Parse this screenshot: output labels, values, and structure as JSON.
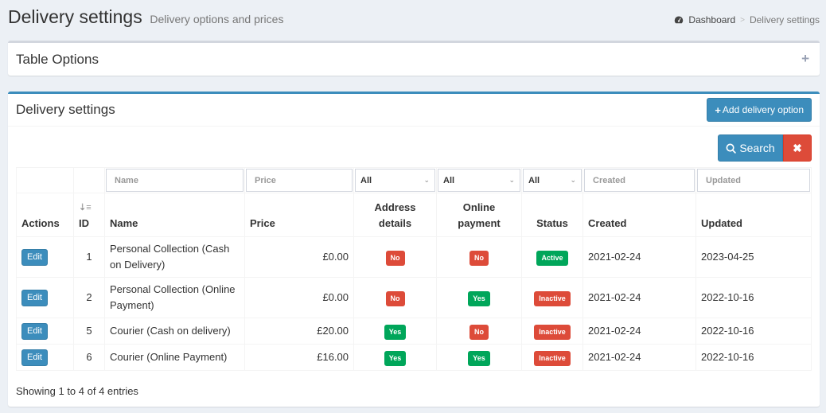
{
  "header": {
    "title": "Delivery settings",
    "subtitle": "Delivery options and prices",
    "breadcrumb": {
      "icon": "dashboard-icon",
      "home": "Dashboard",
      "separator": ">",
      "current": "Delivery settings"
    }
  },
  "table_options": {
    "title": "Table Options",
    "expand_icon": "+"
  },
  "main_box": {
    "title": "Delivery settings",
    "add_button": {
      "icon": "+",
      "label": "Add delivery option"
    },
    "search_button": {
      "icon": "search-icon",
      "label": "Search"
    },
    "clear_button": {
      "icon": "✖"
    }
  },
  "filters": {
    "name_placeholder": "Name",
    "price_placeholder": "Price",
    "address_details": "All",
    "online_payment": "All",
    "status": "All",
    "created_placeholder": "Created",
    "updated_placeholder": "Updated"
  },
  "columns": {
    "actions": "Actions",
    "id": "ID",
    "name": "Name",
    "price": "Price",
    "address_details": "Address details",
    "online_payment": "Online payment",
    "status": "Status",
    "created": "Created",
    "updated": "Updated"
  },
  "rows": [
    {
      "action": "Edit",
      "id": "1",
      "name": "Personal Collection (Cash on Delivery)",
      "price": "£0.00",
      "address": "No",
      "online": "No",
      "status": "Active",
      "created": "2021-02-24",
      "updated": "2023-04-25"
    },
    {
      "action": "Edit",
      "id": "2",
      "name": "Personal Collection (Online Payment)",
      "price": "£0.00",
      "address": "No",
      "online": "Yes",
      "status": "Inactive",
      "created": "2021-02-24",
      "updated": "2022-10-16"
    },
    {
      "action": "Edit",
      "id": "5",
      "name": "Courier (Cash on delivery)",
      "price": "£20.00",
      "address": "Yes",
      "online": "No",
      "status": "Inactive",
      "created": "2021-02-24",
      "updated": "2022-10-16"
    },
    {
      "action": "Edit",
      "id": "6",
      "name": "Courier (Online Payment)",
      "price": "£16.00",
      "address": "Yes",
      "online": "Yes",
      "status": "Inactive",
      "created": "2021-02-24",
      "updated": "2022-10-16"
    }
  ],
  "footer": {
    "showing": "Showing 1 to 4 of 4 entries"
  },
  "colors": {
    "primary": "#3c8dbc",
    "danger": "#dd4b39",
    "success": "#00a65a",
    "background": "#ecf0f5"
  }
}
